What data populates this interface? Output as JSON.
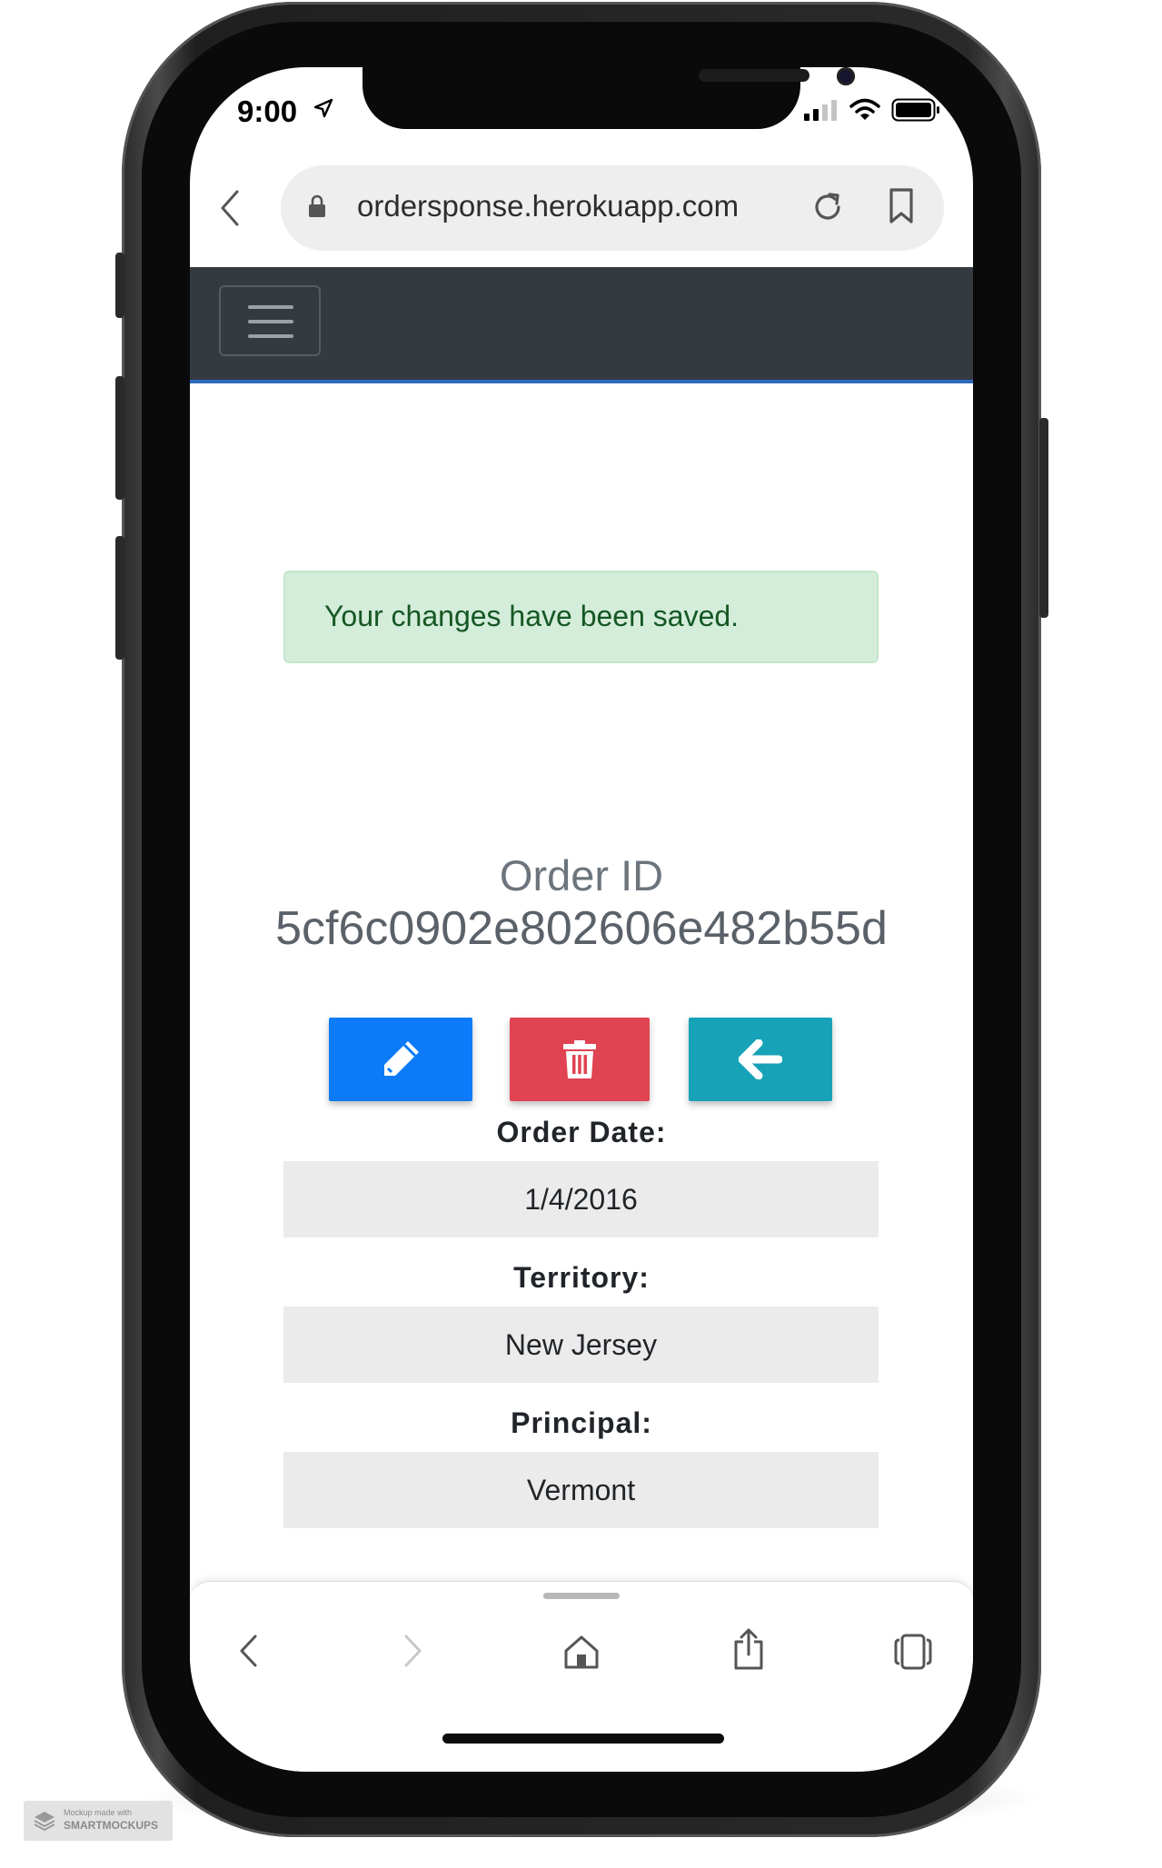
{
  "status_bar": {
    "time": "9:00"
  },
  "browser": {
    "url": "ordersponse.herokuapp.com"
  },
  "alert": {
    "message": "Your changes have been saved."
  },
  "order": {
    "label": "Order ID",
    "id": "5cf6c0902e802606e482b55d"
  },
  "actions": [
    {
      "name": "edit",
      "icon": "pencil-icon",
      "color": "#0d7bf7"
    },
    {
      "name": "delete",
      "icon": "trash-icon",
      "color": "#e04352"
    },
    {
      "name": "back",
      "icon": "arrow-left-icon",
      "color": "#17a2b8"
    }
  ],
  "fields": [
    {
      "label": "Order Date:",
      "value": "1/4/2016"
    },
    {
      "label": "Territory:",
      "value": "New Jersey"
    },
    {
      "label": "Principal:",
      "value": "Vermont"
    }
  ],
  "watermark": {
    "line1": "Mockup made with",
    "line2": "SMARTMOCKUPS"
  },
  "colors": {
    "navbar": "#343a40",
    "alert_bg": "#d4edda",
    "alert_text": "#155724",
    "field_bg": "#ebebeb"
  }
}
